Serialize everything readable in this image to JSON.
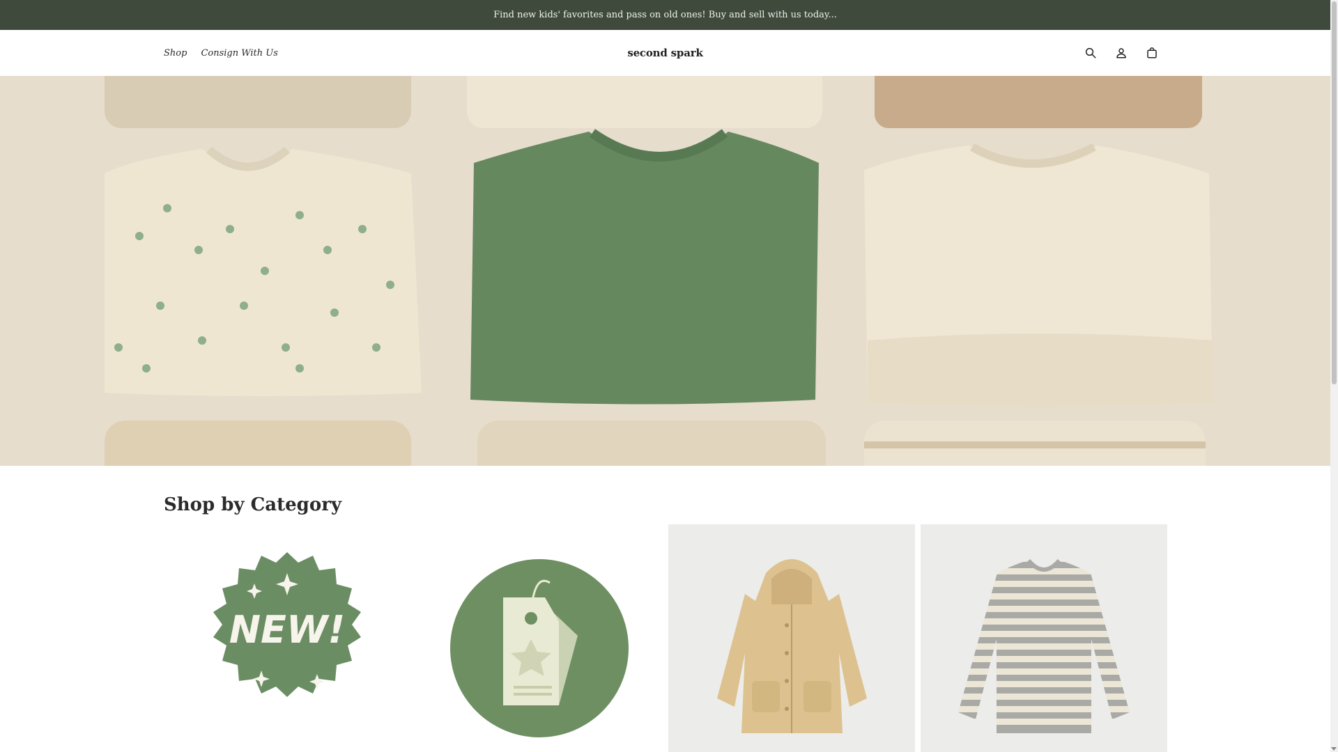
{
  "announcement": "Find new kids' favorites and pass on old ones! Buy and sell with us today...",
  "nav": {
    "shop": "Shop",
    "consign": "Consign With Us"
  },
  "brand": "second spark",
  "header_icons": [
    "search-icon",
    "account-icon",
    "cart-icon"
  ],
  "hero": {
    "image": "folded-kids-sweaters"
  },
  "section": {
    "title": "Shop by Category"
  },
  "categories": [
    {
      "image": "new-badge",
      "badge_text": "NEW!"
    },
    {
      "image": "price-tag-badge"
    },
    {
      "image": "quilted-hooded-jacket"
    },
    {
      "image": "striped-sweater"
    }
  ],
  "colors": {
    "announcement_bg": "#3f4a3d",
    "sage_green": "#6b8d63",
    "cream": "#efe6d3"
  }
}
